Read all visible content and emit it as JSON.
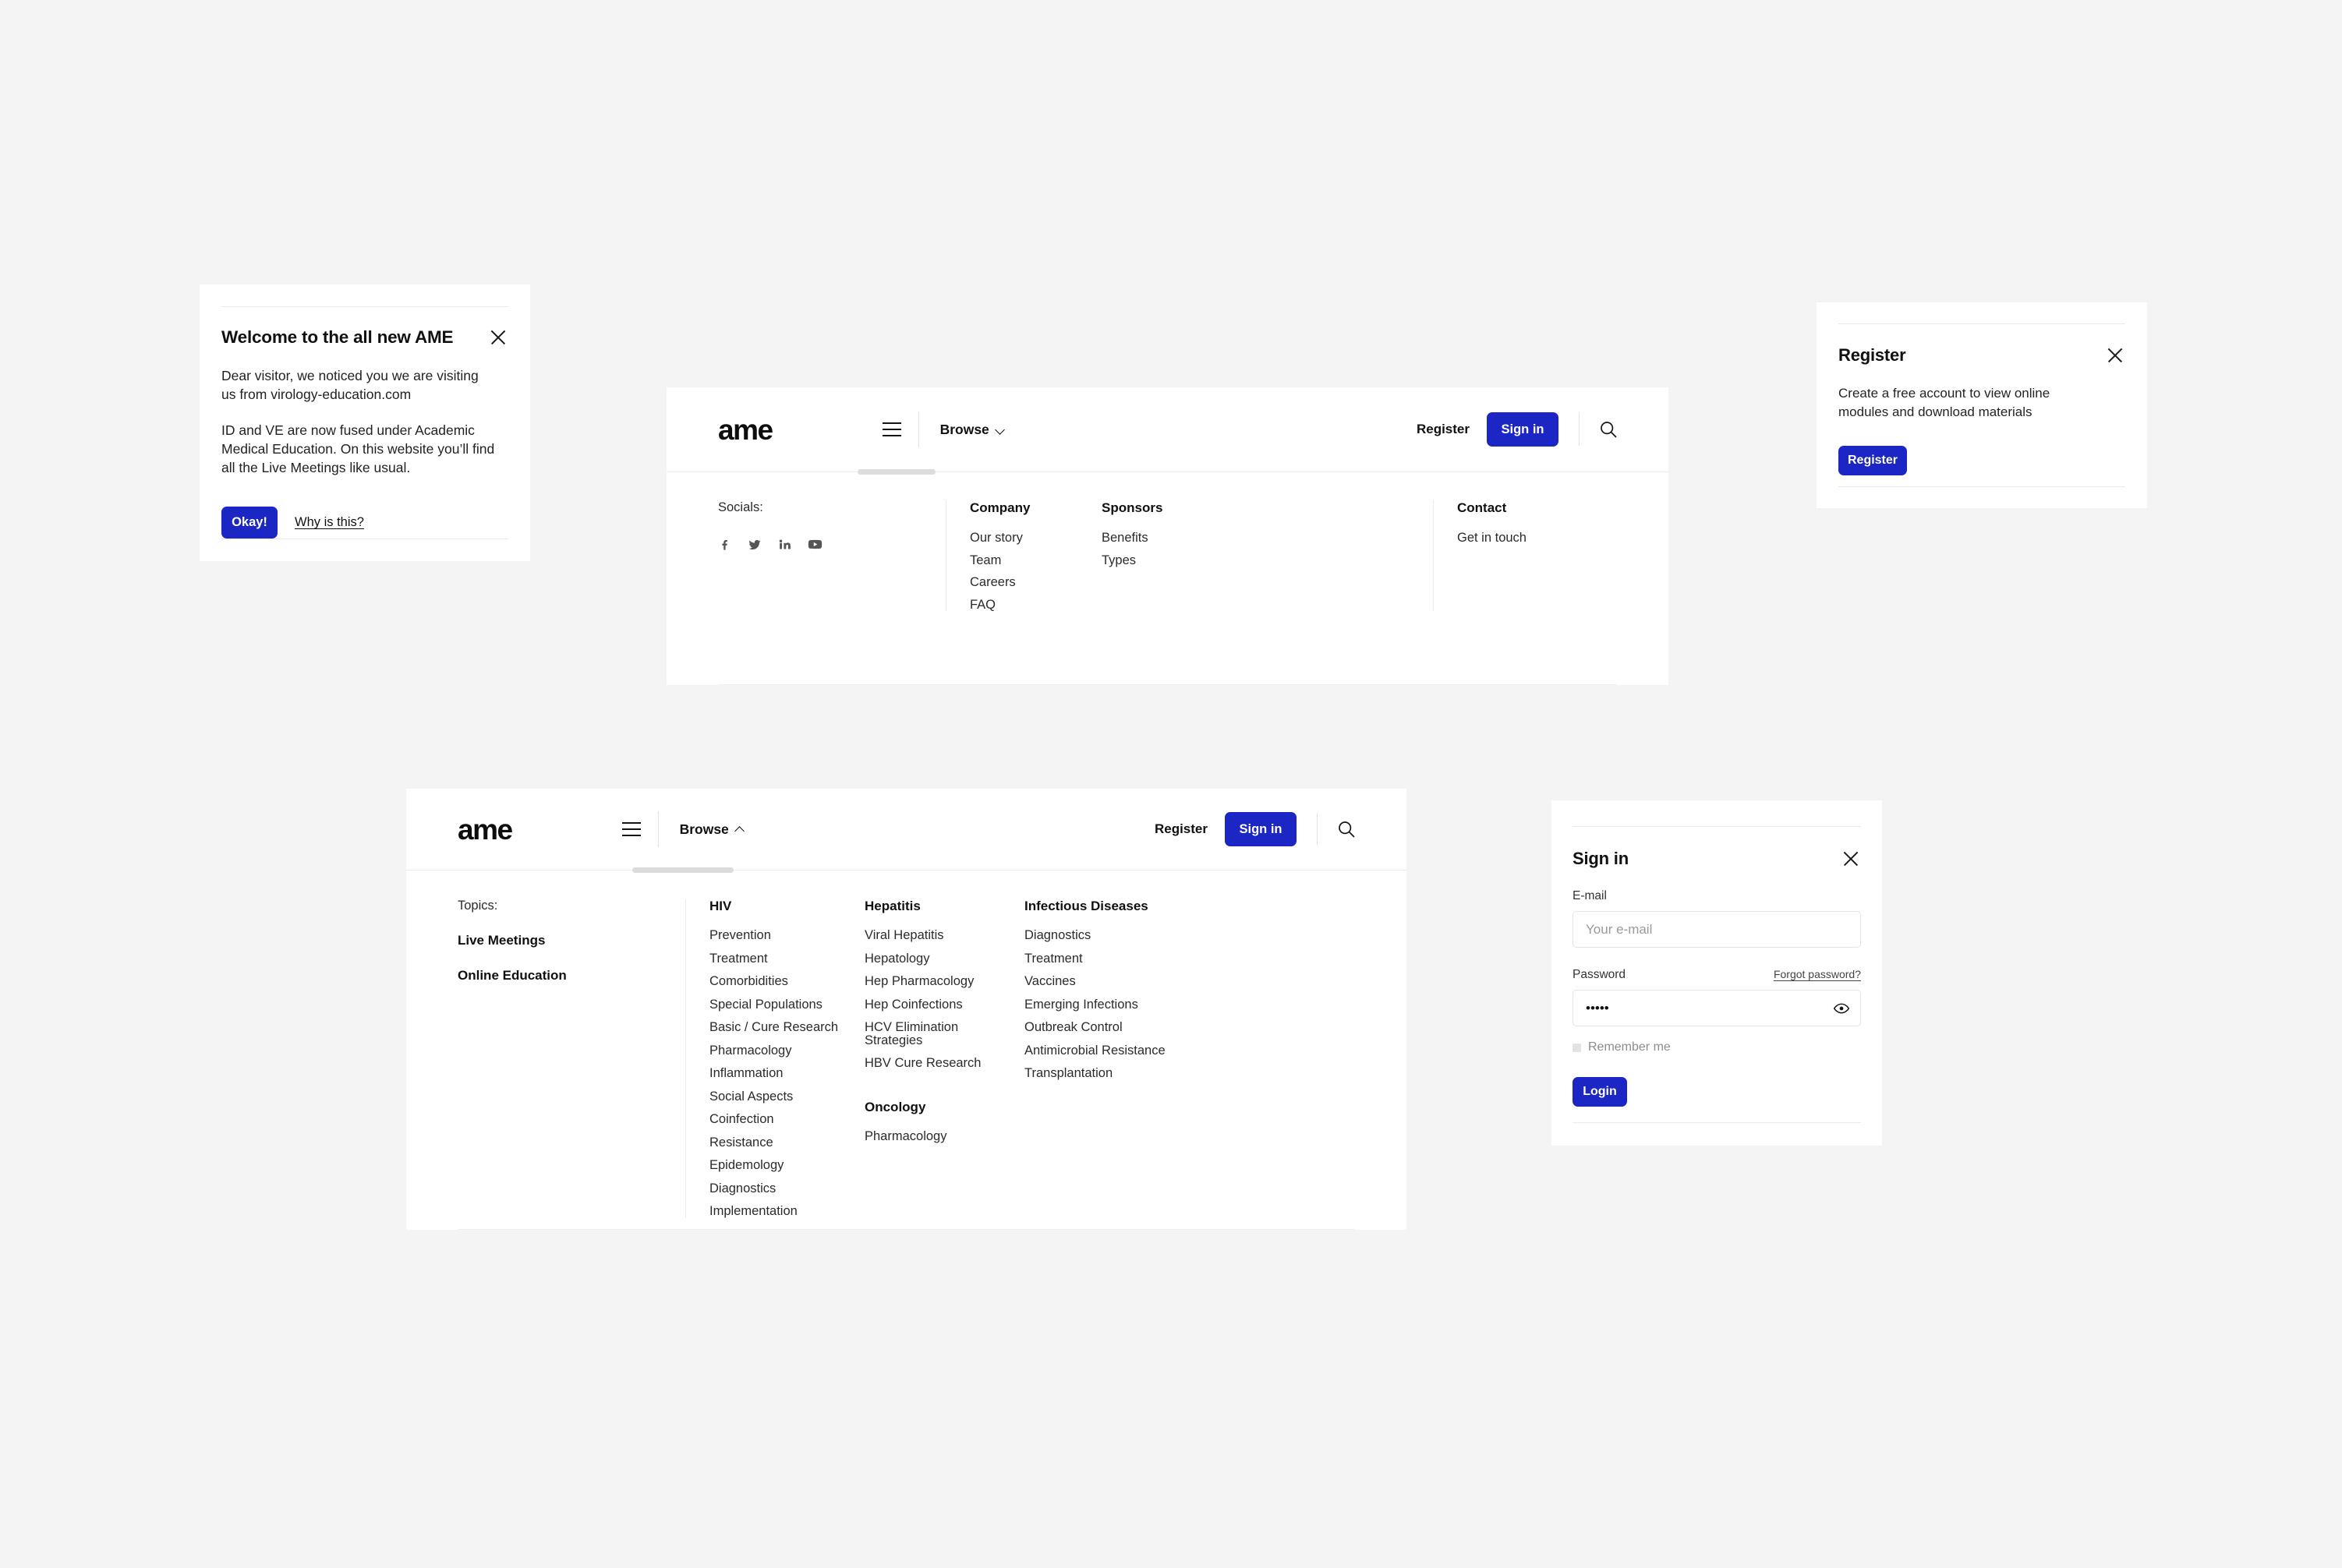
{
  "brand": {
    "logo_text": "ame",
    "accent_color": "#1b26c4"
  },
  "welcome_card": {
    "title": "Welcome to the all new AME",
    "paragraph_1": "Dear visitor, we noticed you we are visiting us from virology-education.com",
    "paragraph_2": "ID and VE are now fused under Academic Medical Education. On this website you’ll find all the Live Meetings like usual.",
    "okay_label": "Okay!",
    "why_label": "Why is this?"
  },
  "nav": {
    "logo_text": "ame",
    "browse_label": "Browse",
    "register_label": "Register",
    "signin_label": "Sign in"
  },
  "footer": {
    "socials_label": "Socials:",
    "socials": [
      {
        "name": "facebook-icon"
      },
      {
        "name": "twitter-icon"
      },
      {
        "name": "linkedin-icon"
      },
      {
        "name": "youtube-icon"
      }
    ],
    "columns": [
      {
        "heading": "Company",
        "items": [
          "Our story",
          "Team",
          "Careers",
          "FAQ"
        ]
      },
      {
        "heading": "Sponsors",
        "items": [
          "Benefits",
          "Types"
        ]
      },
      {
        "heading": "Contact",
        "items": [
          "Get in touch"
        ]
      }
    ]
  },
  "register_card": {
    "title": "Register",
    "description": "Create a free account to view online modules and download materials",
    "button_label": "Register"
  },
  "mega_menu": {
    "browse_label": "Browse",
    "register_label": "Register",
    "signin_label": "Sign in",
    "topics_label": "Topics:",
    "topic_links": [
      "Live Meetings",
      "Online Education"
    ],
    "columns": [
      {
        "heading": "HIV",
        "items": [
          "Prevention",
          "Treatment",
          "Comorbidities",
          "Special Populations",
          "Basic / Cure Research",
          "Pharmacology",
          "Inflammation",
          "Social Aspects",
          "Coinfection",
          "Resistance",
          "Epidemology",
          "Diagnostics",
          "Implementation"
        ]
      },
      {
        "heading": "Hepatitis",
        "items": [
          "Viral Hepatitis",
          "Hepatology",
          "Hep Pharmacology",
          "Hep Coinfections",
          "HCV Elimination Strategies",
          "HBV Cure Research"
        ],
        "heading_2": "Oncology",
        "items_2": [
          "Pharmacology"
        ]
      },
      {
        "heading": "Infectious Diseases",
        "items": [
          "Diagnostics",
          "Treatment",
          "Vaccines",
          "Emerging Infections",
          "Outbreak Control",
          "Antimicrobial Resistance",
          "Transplantation"
        ]
      }
    ]
  },
  "signin_card": {
    "title": "Sign in",
    "email_label": "E-mail",
    "email_placeholder": "Your e-mail",
    "email_value": "",
    "password_label": "Password",
    "password_value": "•••••",
    "forgot_label": "Forgot password?",
    "remember_label": "Remember me",
    "login_label": "Login"
  }
}
